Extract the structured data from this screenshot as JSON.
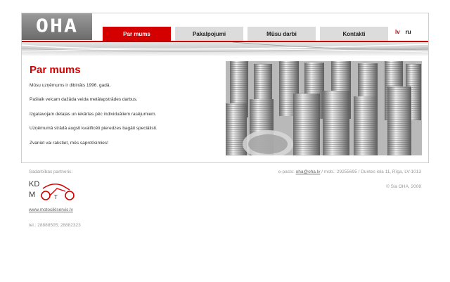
{
  "logo": {
    "text": "OHA"
  },
  "nav": {
    "items": [
      {
        "label": "Par mums",
        "active": true
      },
      {
        "label": "Pakalpojumi",
        "active": false
      },
      {
        "label": "Mūsu darbi",
        "active": false
      },
      {
        "label": "Kontakti",
        "active": false
      }
    ],
    "lang_lv": "lv",
    "lang_ru": "ru"
  },
  "main": {
    "title": "Par mums",
    "paragraphs": [
      "Mūsu uzņēmums ir dibināts 1996. gadā.",
      "Pašlaik veicam dažāda veida metālapstrādes darbus.",
      "Izgatavojam detaļas un iekārtas pēc individuāliem rasējumiem.",
      "Uzņēmumā strādā augsti kvalificēti pieredzes bagāti speciālisti.",
      "Zvaniet vai rakstiet, mēs saprotīsimies!"
    ]
  },
  "footer": {
    "partner_label": "Sadarbības partneris:",
    "partner_logo_kd": "KD",
    "partner_logo_m": "M",
    "partner_link": "www.motociklservis.lv",
    "partner_phone": "tel.: 28888505; 28882323",
    "contact_prefix": "e-pasts: ",
    "email": "oha@oha.lv",
    "contact_suffix": " / mob.: 29255695 / Duntes iela 11, Rīga, LV-1013",
    "copyright": "© Sia OHA, 2008"
  },
  "colors": {
    "accent": "#d40000",
    "nav_inactive": "#dcdcdc",
    "frame_border": "#cfcfcf"
  }
}
